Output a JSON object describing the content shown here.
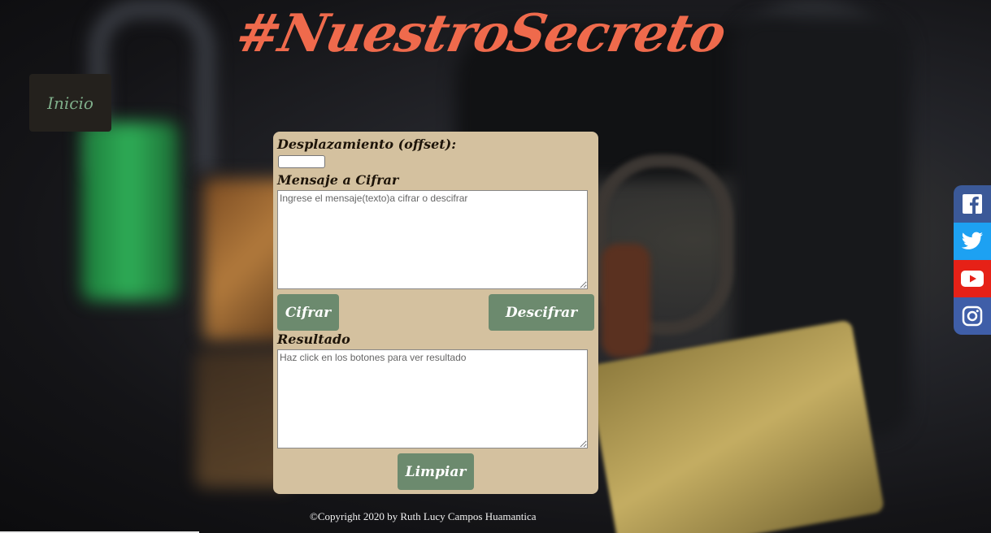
{
  "header": {
    "title": "#NuestroSecreto"
  },
  "nav": {
    "home_label": "Inicio"
  },
  "form": {
    "offset_label": "Desplazamiento (offset):",
    "offset_value": "",
    "message_label": "Mensaje a Cifrar",
    "message_placeholder": "Ingrese el mensaje(texto)a cifrar o descifrar",
    "encrypt_label": "Cifrar",
    "decrypt_label": "Descifrar",
    "result_label": "Resultado",
    "result_placeholder": "Haz click en los botones para ver resultado",
    "clear_label": "Limpiar"
  },
  "footer": {
    "copyright": "©Copyright 2020 by Ruth Lucy Campos Huamantica"
  },
  "social": {
    "icons": [
      "facebook-icon",
      "twitter-icon",
      "youtube-icon",
      "instagram-icon"
    ],
    "colors": {
      "facebook": "#3b5998",
      "twitter": "#1da1f2",
      "youtube": "#e62117",
      "instagram": "#3f5ea8"
    }
  },
  "colors": {
    "title": "#ef6a4c",
    "panel": "#d4c19f",
    "button": "#6c8a6e",
    "nav_bg": "#24211d",
    "nav_text": "#7fae8a"
  }
}
